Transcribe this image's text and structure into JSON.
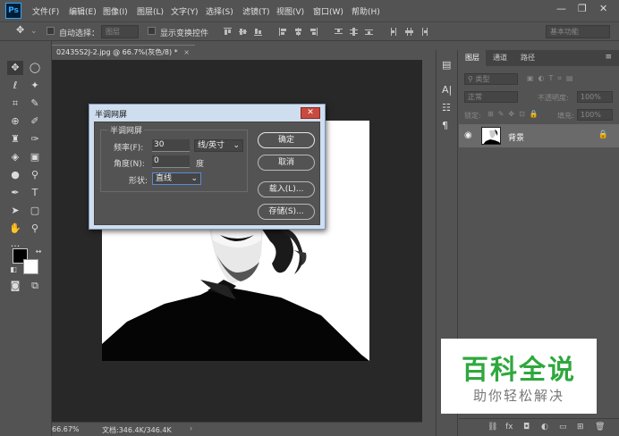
{
  "app": {
    "logo": "Ps",
    "menu": [
      "文件(F)",
      "编辑(E)",
      "图像(I)",
      "图层(L)",
      "文字(Y)",
      "选择(S)",
      "滤镜(T)",
      "视图(V)",
      "窗口(W)",
      "帮助(H)"
    ],
    "window_controls": {
      "minimize": "—",
      "restore": "❐",
      "close": "✕"
    }
  },
  "options_bar": {
    "auto_select_label": "自动选择：",
    "auto_select_value": "图层",
    "show_transform_label": "显示变换控件",
    "workspace_value": "基本功能"
  },
  "document": {
    "tab_label": "02435S2J-2.jpg @ 66.7%(灰色/8) *",
    "tab_close": "×",
    "zoom": "66.67%",
    "doc_info": "文档:346.4K/346.4K"
  },
  "dialog": {
    "title": "半调网屏",
    "close_label": "✕",
    "group_title": "半调网屏",
    "frequency_label": "频率(F):",
    "frequency_value": "30",
    "frequency_unit": "线/英寸",
    "angle_label": "角度(N):",
    "angle_value": "0",
    "angle_unit": "度",
    "shape_label": "形状:",
    "shape_value": "直线",
    "ok_label": "确定",
    "cancel_label": "取消",
    "load_label": "载入(L)...",
    "save_label": "存储(S)..."
  },
  "layers_panel": {
    "tabs": [
      "图层",
      "通道",
      "路径"
    ],
    "filter_label": "类型",
    "blend_mode": "正常",
    "opacity_label": "不透明度:",
    "opacity_value": "100%",
    "lock_label": "锁定:",
    "fill_label": "填充:",
    "fill_value": "100%",
    "layer_name": "背景"
  },
  "watermark": {
    "title": "百科全说",
    "subtitle": "助你轻松解决"
  },
  "colors": {
    "ui_bg": "#535353",
    "canvas_bg": "#282828",
    "dialog_frame": "#cfdeef",
    "watermark_green": "#2fa83d",
    "ps_blue": "#31a8ff"
  }
}
